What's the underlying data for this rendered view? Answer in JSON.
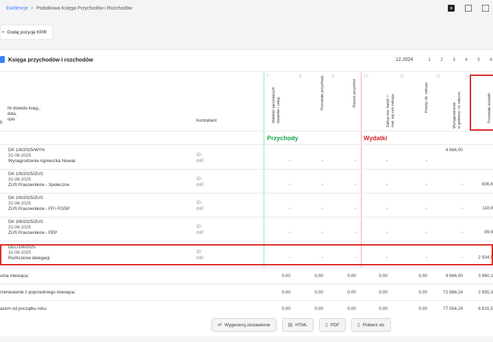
{
  "breadcrumb": {
    "link": "Ewidencje",
    "sep": ">",
    "current": "Podatkowa Księga Przychodów i Rozchodów"
  },
  "add_button": {
    "icon": "plus-icon",
    "label": "Dodaj pozycję KPiR"
  },
  "card": {
    "title": "Księga przychodów i rozchodów",
    "period": "12.2024",
    "pages": [
      "1",
      "2",
      "3",
      "4",
      "5",
      "6"
    ]
  },
  "headers": {
    "lp": "p.",
    "doc_lines": [
      "Nr dowodu księg.,",
      "data,",
      "opis"
    ],
    "contractor": "Kontrahent",
    "col_numbers": [
      "7",
      "8",
      "9",
      "10",
      "11",
      "12",
      "1"
    ],
    "columns": [
      {
        "label_lines": [
          "Wartość sprzedanych",
          "towarów i usług"
        ]
      },
      {
        "label_lines": [
          "Pozostałe przychody"
        ]
      },
      {
        "label_lines": [
          "Razem przychód"
        ]
      },
      {
        "label_lines": [
          "Zakup tow. handl. i",
          "mat. wg cen zakupu"
        ]
      },
      {
        "label_lines": [
          "Koszty ub. zakupu"
        ]
      },
      {
        "label_lines": [
          "Wynagrodzenia",
          "w gotówce i w naturze"
        ]
      },
      {
        "label_lines": [
          "Pozostałe wydatki"
        ]
      }
    ],
    "section_income": "Przychody",
    "section_expense": "Wydatki"
  },
  "rows": [
    {
      "doc": "DK 1/8/2025/WYN",
      "date": "31-08-2025",
      "desc": "Wynagrodzenie Agnieszka Nowak",
      "id": "ID:",
      "nip": "NIP:",
      "values": [
        "-",
        "-",
        "-",
        "-",
        "-",
        "4 666,00",
        ""
      ]
    },
    {
      "doc": "DK 1/8/2025/ZUS",
      "date": "31-08-2025",
      "desc": "ZUS Pracowników - Społeczne",
      "id": "ID:",
      "nip": "NIP:",
      "values": [
        "-",
        "-",
        "-",
        "-",
        "-",
        "-",
        "836,6"
      ]
    },
    {
      "doc": "DK 2/8/2025/ZUS",
      "date": "31-08-2025",
      "desc": "ZUS Pracowników - FP i FGŚP",
      "id": "ID:",
      "nip": "NIP:",
      "values": [
        "-",
        "-",
        "-",
        "-",
        "-",
        "-",
        "118,9"
      ]
    },
    {
      "doc": "DK 3/8/2025/ZUS",
      "date": "31-08-2025",
      "desc": "ZUS Pracowników - FEP",
      "id": "ID:",
      "nip": "NIP:",
      "values": [
        "-",
        "-",
        "-",
        "-",
        "-",
        "-",
        "99,9"
      ]
    },
    {
      "doc": "DEL/1/8/2025",
      "date": "31-08-2025",
      "desc": "Rozliczenie delegacji",
      "id": "ID:",
      "nip": "NIP:",
      "values": [
        "-",
        "-",
        "-",
        "-",
        "-",
        "-",
        "2 934,5"
      ]
    }
  ],
  "summary": [
    {
      "label": "uma miesiąca:",
      "values": [
        "0,00",
        "0,00",
        "0,00",
        "0,00",
        "0,00",
        "4 666,00",
        "3 960,1"
      ]
    },
    {
      "label": "rzeniesienie z poprzedniego miesiąca:",
      "values": [
        "0,00",
        "0,00",
        "0,00",
        "0,00",
        "0,00",
        "72 888,24",
        "2 855,3"
      ]
    },
    {
      "label": "azem od początku roku:",
      "values": [
        "0,00",
        "0,00",
        "0,00",
        "0,00",
        "0,00",
        "77 554,24",
        "6 815,5"
      ]
    }
  ],
  "footer": {
    "generate": "Wygeneruj zestawienie",
    "html": "HTML",
    "pdf": "PDF",
    "xls": "Pobierz xls"
  }
}
